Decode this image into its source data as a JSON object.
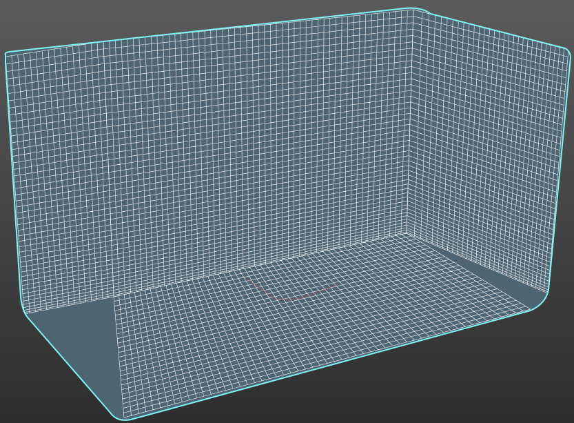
{
  "viewport": {
    "background_top": "#5b5b5b",
    "background_bottom": "#2e2e2e"
  },
  "mesh": {
    "selection_outline_color": "#7ff3f3",
    "wire_color": "#ffffff",
    "surface_color": "#4d6472",
    "highlight_edge_color": "#b04a55"
  }
}
